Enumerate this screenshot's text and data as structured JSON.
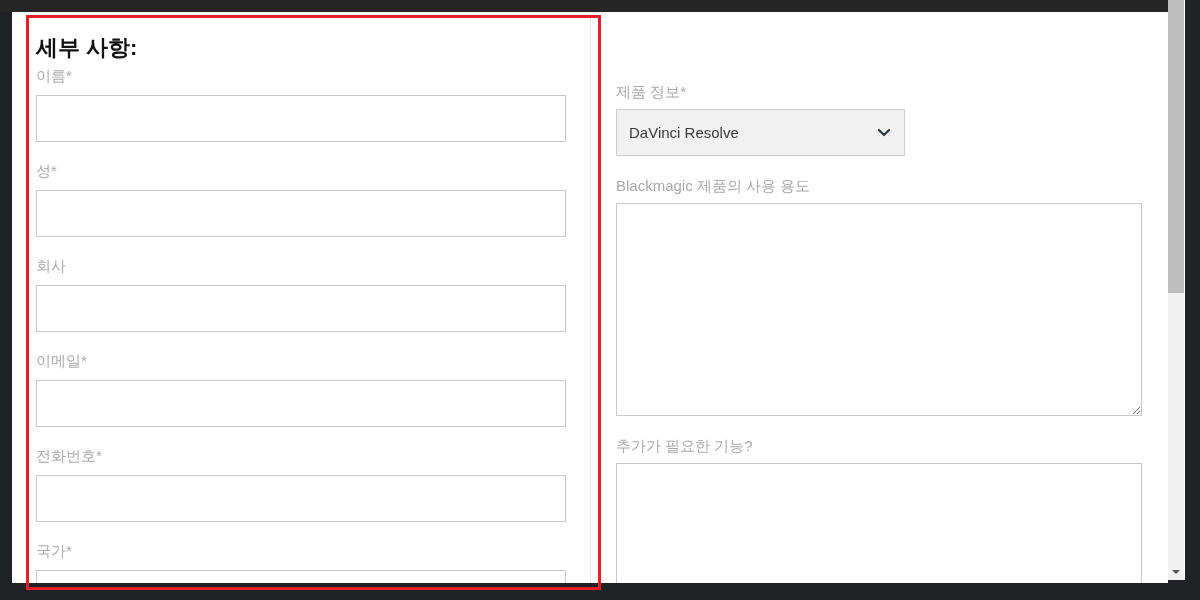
{
  "details": {
    "title": "세부 사항:",
    "highlighted": true,
    "fields": [
      {
        "label": "이름*"
      },
      {
        "label": "성*"
      },
      {
        "label": "회사"
      },
      {
        "label": "이메일*"
      },
      {
        "label": "전화번호*"
      },
      {
        "label": "국가*"
      }
    ]
  },
  "product": {
    "fields": [
      {
        "kind": "select",
        "label": "제품 정보*",
        "value": "DaVinci Resolve"
      },
      {
        "kind": "textarea",
        "label": "Blackmagic 제품의 사용 용도"
      },
      {
        "kind": "textarea",
        "label": "추가가 필요한 기능?"
      }
    ]
  }
}
